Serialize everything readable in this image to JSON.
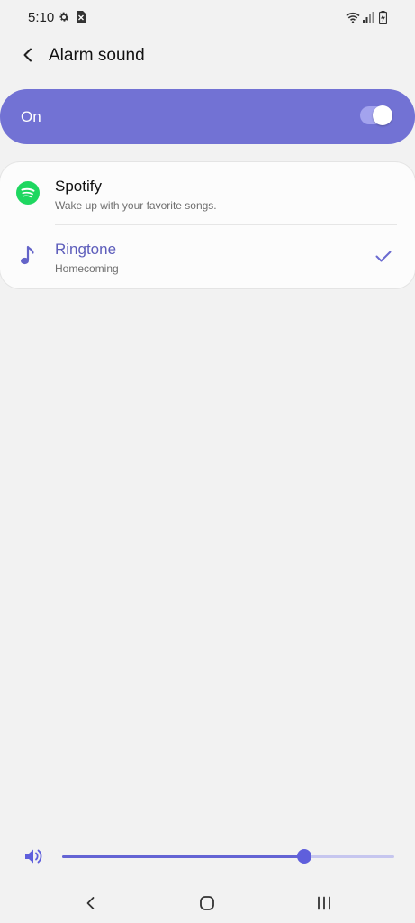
{
  "status_bar": {
    "time": "5:10",
    "icons": [
      "settings-icon",
      "sim-card-icon",
      "wifi-icon",
      "signal-icon",
      "battery-charging-icon"
    ]
  },
  "header": {
    "title": "Alarm sound",
    "back_icon": "chevron-left-icon"
  },
  "master_switch": {
    "label": "On",
    "state": true
  },
  "options": [
    {
      "title": "Spotify",
      "subtitle": "Wake up with your favorite songs.",
      "icon": "spotify-icon",
      "selected": false
    },
    {
      "title": "Ringtone",
      "subtitle": "Homecoming",
      "icon": "music-note-icon",
      "selected": true
    }
  ],
  "volume": {
    "icon": "speaker-icon",
    "level": 0.73
  },
  "nav_bar": {
    "icons": [
      "nav-back-icon",
      "nav-home-icon",
      "nav-recents-icon"
    ]
  },
  "colors": {
    "accent": "#7272d4",
    "selected_text": "#5d5dbb",
    "spotify_green": "#1ed760",
    "background": "#f2f2f2"
  }
}
